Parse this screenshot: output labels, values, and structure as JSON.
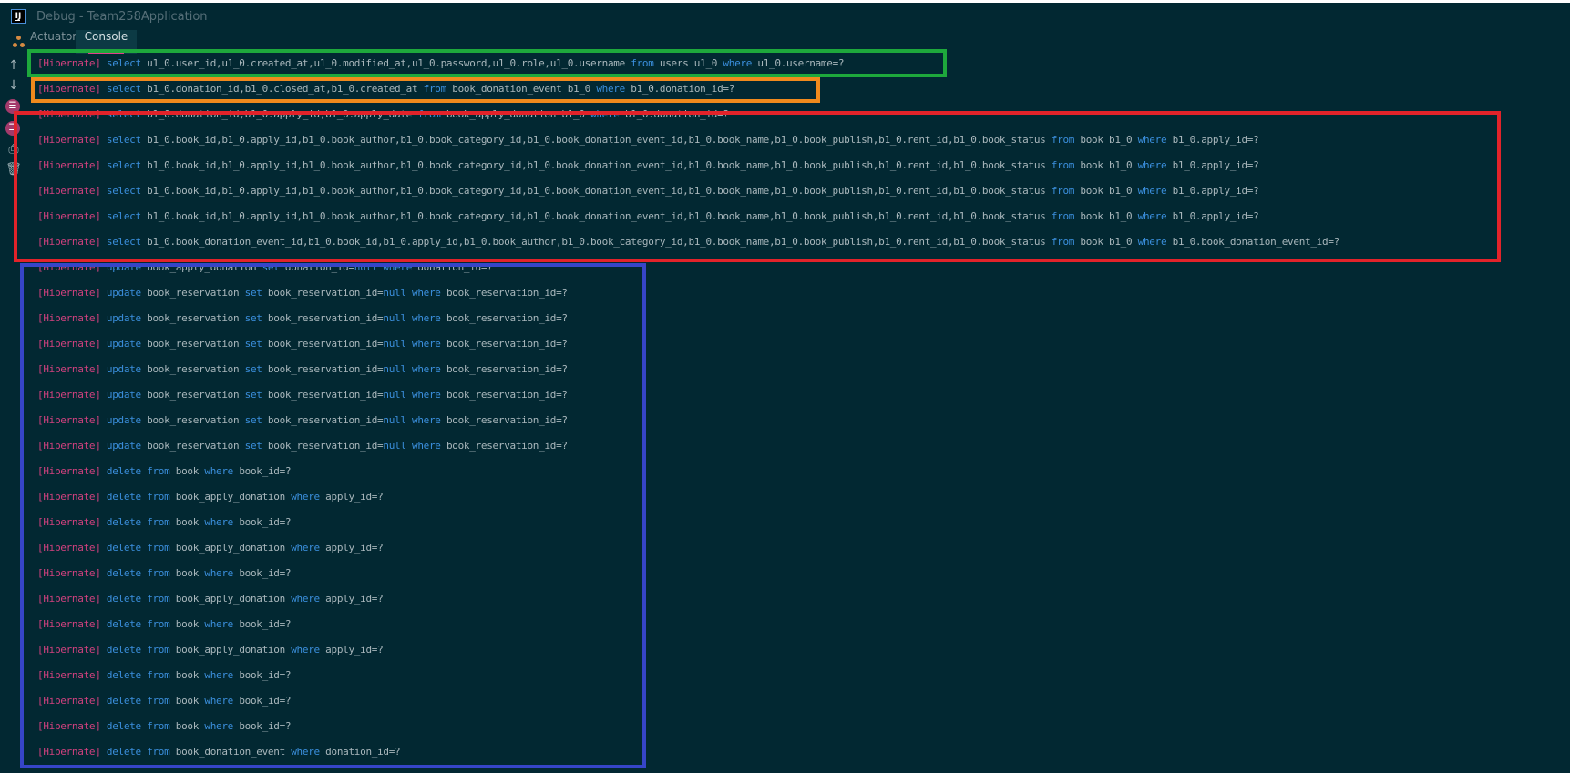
{
  "window": {
    "title": "Debug - Team258Application",
    "logo": "IJ"
  },
  "tabs": [
    {
      "label": "Actuator",
      "icon": "actuator-icon",
      "active": false
    },
    {
      "label": "Console",
      "active": true
    }
  ],
  "toolbar": {
    "icons": [
      "scroll-up-icon",
      "scroll-down-icon",
      "soft-wrap-icon",
      "scroll-to-end-icon",
      "print-icon",
      "clear-icon"
    ]
  },
  "colors": {
    "background": "#022832",
    "tag": "#d0417e",
    "keyword": "#3b8fdd",
    "text": "#a9b7bc",
    "highlight_green": "#1ea83c",
    "highlight_orange": "#f08a1d",
    "highlight_red": "#e2232a",
    "highlight_blue": "#3645c8"
  },
  "console": {
    "lines": [
      [
        [
          "tag",
          "[Hibernate]"
        ],
        [
          "txt",
          " "
        ],
        [
          "kw",
          "select"
        ],
        [
          "txt",
          " u1_0.user_id,u1_0.created_at,u1_0.modified_at,u1_0.password,u1_0.role,u1_0.username "
        ],
        [
          "kw",
          "from"
        ],
        [
          "txt",
          " users u1_0 "
        ],
        [
          "kw",
          "where"
        ],
        [
          "txt",
          " u1_0.username=?"
        ]
      ],
      [
        [
          "tag",
          "[Hibernate]"
        ],
        [
          "txt",
          " "
        ],
        [
          "kw",
          "select"
        ],
        [
          "txt",
          " b1_0.donation_id,b1_0.closed_at,b1_0.created_at "
        ],
        [
          "kw",
          "from"
        ],
        [
          "txt",
          " book_donation_event b1_0 "
        ],
        [
          "kw",
          "where"
        ],
        [
          "txt",
          " b1_0.donation_id=?"
        ]
      ],
      [
        [
          "tag",
          "[Hibernate]"
        ],
        [
          "txt",
          " "
        ],
        [
          "kw",
          "select"
        ],
        [
          "txt",
          " b1_0.donation_id,b1_0.apply_id,b1_0.apply_date "
        ],
        [
          "kw",
          "from"
        ],
        [
          "txt",
          " book_apply_donation b1_0 "
        ],
        [
          "kw",
          "where"
        ],
        [
          "txt",
          " b1_0.donation_id=?"
        ]
      ],
      [
        [
          "tag",
          "[Hibernate]"
        ],
        [
          "txt",
          " "
        ],
        [
          "kw",
          "select"
        ],
        [
          "txt",
          " b1_0.book_id,b1_0.apply_id,b1_0.book_author,b1_0.book_category_id,b1_0.book_donation_event_id,b1_0.book_name,b1_0.book_publish,b1_0.rent_id,b1_0.book_status "
        ],
        [
          "kw",
          "from"
        ],
        [
          "txt",
          " book b1_0 "
        ],
        [
          "kw",
          "where"
        ],
        [
          "txt",
          " b1_0.apply_id=?"
        ]
      ],
      [
        [
          "tag",
          "[Hibernate]"
        ],
        [
          "txt",
          " "
        ],
        [
          "kw",
          "select"
        ],
        [
          "txt",
          " b1_0.book_id,b1_0.apply_id,b1_0.book_author,b1_0.book_category_id,b1_0.book_donation_event_id,b1_0.book_name,b1_0.book_publish,b1_0.rent_id,b1_0.book_status "
        ],
        [
          "kw",
          "from"
        ],
        [
          "txt",
          " book b1_0 "
        ],
        [
          "kw",
          "where"
        ],
        [
          "txt",
          " b1_0.apply_id=?"
        ]
      ],
      [
        [
          "tag",
          "[Hibernate]"
        ],
        [
          "txt",
          " "
        ],
        [
          "kw",
          "select"
        ],
        [
          "txt",
          " b1_0.book_id,b1_0.apply_id,b1_0.book_author,b1_0.book_category_id,b1_0.book_donation_event_id,b1_0.book_name,b1_0.book_publish,b1_0.rent_id,b1_0.book_status "
        ],
        [
          "kw",
          "from"
        ],
        [
          "txt",
          " book b1_0 "
        ],
        [
          "kw",
          "where"
        ],
        [
          "txt",
          " b1_0.apply_id=?"
        ]
      ],
      [
        [
          "tag",
          "[Hibernate]"
        ],
        [
          "txt",
          " "
        ],
        [
          "kw",
          "select"
        ],
        [
          "txt",
          " b1_0.book_id,b1_0.apply_id,b1_0.book_author,b1_0.book_category_id,b1_0.book_donation_event_id,b1_0.book_name,b1_0.book_publish,b1_0.rent_id,b1_0.book_status "
        ],
        [
          "kw",
          "from"
        ],
        [
          "txt",
          " book b1_0 "
        ],
        [
          "kw",
          "where"
        ],
        [
          "txt",
          " b1_0.apply_id=?"
        ]
      ],
      [
        [
          "tag",
          "[Hibernate]"
        ],
        [
          "txt",
          " "
        ],
        [
          "kw",
          "select"
        ],
        [
          "txt",
          " b1_0.book_donation_event_id,b1_0.book_id,b1_0.apply_id,b1_0.book_author,b1_0.book_category_id,b1_0.book_name,b1_0.book_publish,b1_0.rent_id,b1_0.book_status "
        ],
        [
          "kw",
          "from"
        ],
        [
          "txt",
          " book b1_0 "
        ],
        [
          "kw",
          "where"
        ],
        [
          "txt",
          " b1_0.book_donation_event_id=?"
        ]
      ],
      [
        [
          "tag",
          "[Hibernate]"
        ],
        [
          "txt",
          " "
        ],
        [
          "kw",
          "update"
        ],
        [
          "txt",
          " book_apply_donation "
        ],
        [
          "kw",
          "set"
        ],
        [
          "txt",
          " donation_id="
        ],
        [
          "kw",
          "null"
        ],
        [
          "txt",
          " "
        ],
        [
          "kw",
          "where"
        ],
        [
          "txt",
          " donation_id=?"
        ]
      ],
      [
        [
          "tag",
          "[Hibernate]"
        ],
        [
          "txt",
          " "
        ],
        [
          "kw",
          "update"
        ],
        [
          "txt",
          " book_reservation "
        ],
        [
          "kw",
          "set"
        ],
        [
          "txt",
          " book_reservation_id="
        ],
        [
          "kw",
          "null"
        ],
        [
          "txt",
          " "
        ],
        [
          "kw",
          "where"
        ],
        [
          "txt",
          " book_reservation_id=?"
        ]
      ],
      [
        [
          "tag",
          "[Hibernate]"
        ],
        [
          "txt",
          " "
        ],
        [
          "kw",
          "update"
        ],
        [
          "txt",
          " book_reservation "
        ],
        [
          "kw",
          "set"
        ],
        [
          "txt",
          " book_reservation_id="
        ],
        [
          "kw",
          "null"
        ],
        [
          "txt",
          " "
        ],
        [
          "kw",
          "where"
        ],
        [
          "txt",
          " book_reservation_id=?"
        ]
      ],
      [
        [
          "tag",
          "[Hibernate]"
        ],
        [
          "txt",
          " "
        ],
        [
          "kw",
          "update"
        ],
        [
          "txt",
          " book_reservation "
        ],
        [
          "kw",
          "set"
        ],
        [
          "txt",
          " book_reservation_id="
        ],
        [
          "kw",
          "null"
        ],
        [
          "txt",
          " "
        ],
        [
          "kw",
          "where"
        ],
        [
          "txt",
          " book_reservation_id=?"
        ]
      ],
      [
        [
          "tag",
          "[Hibernate]"
        ],
        [
          "txt",
          " "
        ],
        [
          "kw",
          "update"
        ],
        [
          "txt",
          " book_reservation "
        ],
        [
          "kw",
          "set"
        ],
        [
          "txt",
          " book_reservation_id="
        ],
        [
          "kw",
          "null"
        ],
        [
          "txt",
          " "
        ],
        [
          "kw",
          "where"
        ],
        [
          "txt",
          " book_reservation_id=?"
        ]
      ],
      [
        [
          "tag",
          "[Hibernate]"
        ],
        [
          "txt",
          " "
        ],
        [
          "kw",
          "update"
        ],
        [
          "txt",
          " book_reservation "
        ],
        [
          "kw",
          "set"
        ],
        [
          "txt",
          " book_reservation_id="
        ],
        [
          "kw",
          "null"
        ],
        [
          "txt",
          " "
        ],
        [
          "kw",
          "where"
        ],
        [
          "txt",
          " book_reservation_id=?"
        ]
      ],
      [
        [
          "tag",
          "[Hibernate]"
        ],
        [
          "txt",
          " "
        ],
        [
          "kw",
          "update"
        ],
        [
          "txt",
          " book_reservation "
        ],
        [
          "kw",
          "set"
        ],
        [
          "txt",
          " book_reservation_id="
        ],
        [
          "kw",
          "null"
        ],
        [
          "txt",
          " "
        ],
        [
          "kw",
          "where"
        ],
        [
          "txt",
          " book_reservation_id=?"
        ]
      ],
      [
        [
          "tag",
          "[Hibernate]"
        ],
        [
          "txt",
          " "
        ],
        [
          "kw",
          "update"
        ],
        [
          "txt",
          " book_reservation "
        ],
        [
          "kw",
          "set"
        ],
        [
          "txt",
          " book_reservation_id="
        ],
        [
          "kw",
          "null"
        ],
        [
          "txt",
          " "
        ],
        [
          "kw",
          "where"
        ],
        [
          "txt",
          " book_reservation_id=?"
        ]
      ],
      [
        [
          "tag",
          "[Hibernate]"
        ],
        [
          "txt",
          " "
        ],
        [
          "kw",
          "delete"
        ],
        [
          "txt",
          " "
        ],
        [
          "kw",
          "from"
        ],
        [
          "txt",
          " book "
        ],
        [
          "kw",
          "where"
        ],
        [
          "txt",
          " book_id=?"
        ]
      ],
      [
        [
          "tag",
          "[Hibernate]"
        ],
        [
          "txt",
          " "
        ],
        [
          "kw",
          "delete"
        ],
        [
          "txt",
          " "
        ],
        [
          "kw",
          "from"
        ],
        [
          "txt",
          " book_apply_donation "
        ],
        [
          "kw",
          "where"
        ],
        [
          "txt",
          " apply_id=?"
        ]
      ],
      [
        [
          "tag",
          "[Hibernate]"
        ],
        [
          "txt",
          " "
        ],
        [
          "kw",
          "delete"
        ],
        [
          "txt",
          " "
        ],
        [
          "kw",
          "from"
        ],
        [
          "txt",
          " book "
        ],
        [
          "kw",
          "where"
        ],
        [
          "txt",
          " book_id=?"
        ]
      ],
      [
        [
          "tag",
          "[Hibernate]"
        ],
        [
          "txt",
          " "
        ],
        [
          "kw",
          "delete"
        ],
        [
          "txt",
          " "
        ],
        [
          "kw",
          "from"
        ],
        [
          "txt",
          " book_apply_donation "
        ],
        [
          "kw",
          "where"
        ],
        [
          "txt",
          " apply_id=?"
        ]
      ],
      [
        [
          "tag",
          "[Hibernate]"
        ],
        [
          "txt",
          " "
        ],
        [
          "kw",
          "delete"
        ],
        [
          "txt",
          " "
        ],
        [
          "kw",
          "from"
        ],
        [
          "txt",
          " book "
        ],
        [
          "kw",
          "where"
        ],
        [
          "txt",
          " book_id=?"
        ]
      ],
      [
        [
          "tag",
          "[Hibernate]"
        ],
        [
          "txt",
          " "
        ],
        [
          "kw",
          "delete"
        ],
        [
          "txt",
          " "
        ],
        [
          "kw",
          "from"
        ],
        [
          "txt",
          " book_apply_donation "
        ],
        [
          "kw",
          "where"
        ],
        [
          "txt",
          " apply_id=?"
        ]
      ],
      [
        [
          "tag",
          "[Hibernate]"
        ],
        [
          "txt",
          " "
        ],
        [
          "kw",
          "delete"
        ],
        [
          "txt",
          " "
        ],
        [
          "kw",
          "from"
        ],
        [
          "txt",
          " book "
        ],
        [
          "kw",
          "where"
        ],
        [
          "txt",
          " book_id=?"
        ]
      ],
      [
        [
          "tag",
          "[Hibernate]"
        ],
        [
          "txt",
          " "
        ],
        [
          "kw",
          "delete"
        ],
        [
          "txt",
          " "
        ],
        [
          "kw",
          "from"
        ],
        [
          "txt",
          " book_apply_donation "
        ],
        [
          "kw",
          "where"
        ],
        [
          "txt",
          " apply_id=?"
        ]
      ],
      [
        [
          "tag",
          "[Hibernate]"
        ],
        [
          "txt",
          " "
        ],
        [
          "kw",
          "delete"
        ],
        [
          "txt",
          " "
        ],
        [
          "kw",
          "from"
        ],
        [
          "txt",
          " book "
        ],
        [
          "kw",
          "where"
        ],
        [
          "txt",
          " book_id=?"
        ]
      ],
      [
        [
          "tag",
          "[Hibernate]"
        ],
        [
          "txt",
          " "
        ],
        [
          "kw",
          "delete"
        ],
        [
          "txt",
          " "
        ],
        [
          "kw",
          "from"
        ],
        [
          "txt",
          " book "
        ],
        [
          "kw",
          "where"
        ],
        [
          "txt",
          " book_id=?"
        ]
      ],
      [
        [
          "tag",
          "[Hibernate]"
        ],
        [
          "txt",
          " "
        ],
        [
          "kw",
          "delete"
        ],
        [
          "txt",
          " "
        ],
        [
          "kw",
          "from"
        ],
        [
          "txt",
          " book "
        ],
        [
          "kw",
          "where"
        ],
        [
          "txt",
          " book_id=?"
        ]
      ],
      [
        [
          "tag",
          "[Hibernate]"
        ],
        [
          "txt",
          " "
        ],
        [
          "kw",
          "delete"
        ],
        [
          "txt",
          " "
        ],
        [
          "kw",
          "from"
        ],
        [
          "txt",
          " book_donation_event "
        ],
        [
          "kw",
          "where"
        ],
        [
          "txt",
          " donation_id=?"
        ]
      ]
    ]
  },
  "highlights": [
    {
      "name": "highlight-green-box",
      "color": "#1ea83c"
    },
    {
      "name": "highlight-orange-box",
      "color": "#f08a1d"
    },
    {
      "name": "highlight-red-box",
      "color": "#e2232a"
    },
    {
      "name": "highlight-blue-box",
      "color": "#3645c8"
    }
  ]
}
